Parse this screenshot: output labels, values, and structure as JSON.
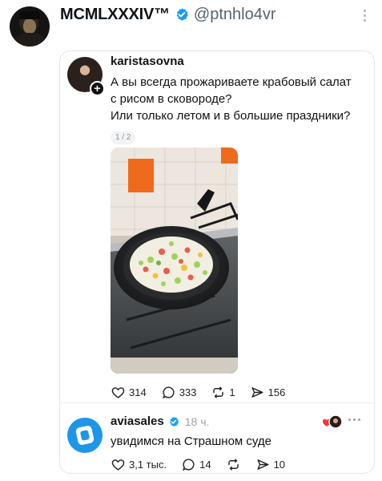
{
  "tweet": {
    "display_name": "MCMLXXXIV™",
    "handle": "@ptnhlo4vr",
    "avatar_icon": "avatar-cat-in-hat",
    "verified_icon": "verified-badge-icon",
    "more_icon": "more-vertical-icon",
    "accent_color": "#1d9bf0"
  },
  "post": {
    "username": "karistasovna",
    "text_lines": [
      "А вы всегда прожариваете крабовый салат",
      "с рисом в сковороде?",
      "Или только летом и в большие праздники?"
    ],
    "pager": "1 / 2",
    "photo_icon": "photo-frying-pan-crab-salad",
    "actions": {
      "likes": "314",
      "replies": "333",
      "reposts": "1",
      "shares": "156"
    }
  },
  "reply": {
    "username": "aviasales",
    "time": "18 ч.",
    "text": "увидимся на Страшном суде",
    "brand_color": "#1e96e8",
    "actions": {
      "likes": "3,1 тыс.",
      "replies": "14",
      "shares": "10"
    }
  }
}
